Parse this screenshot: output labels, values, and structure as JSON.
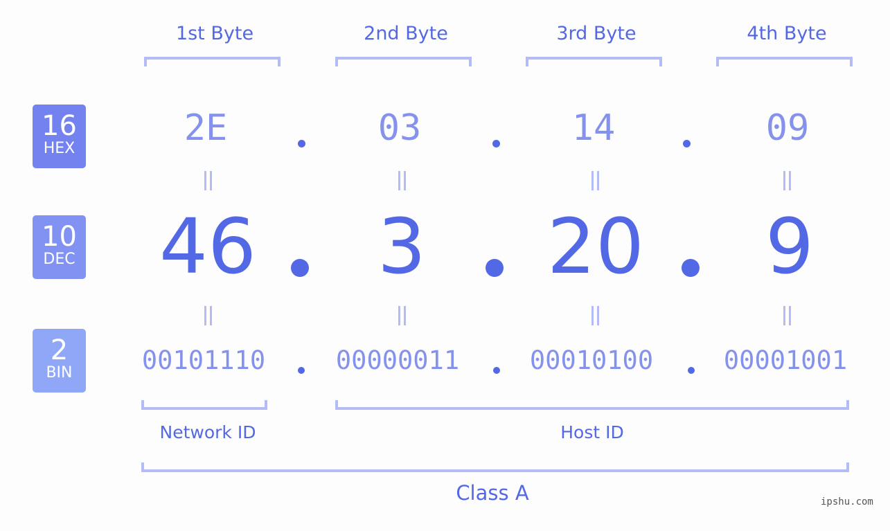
{
  "bytes": [
    {
      "title": "1st Byte",
      "hex": "2E",
      "dec": "46",
      "bin": "00101110"
    },
    {
      "title": "2nd Byte",
      "hex": "03",
      "dec": "3",
      "bin": "00000011"
    },
    {
      "title": "3rd Byte",
      "hex": "14",
      "dec": "20",
      "bin": "00010100"
    },
    {
      "title": "4th Byte",
      "hex": "09",
      "dec": "9",
      "bin": "00001001"
    }
  ],
  "badges": {
    "hex": {
      "num": "16",
      "label": "HEX",
      "color": "#7382ee"
    },
    "dec": {
      "num": "10",
      "label": "DEC",
      "color": "#8292f2"
    },
    "bin": {
      "num": "2",
      "label": "BIN",
      "color": "#90a7f8"
    }
  },
  "sections": {
    "network": "Network ID",
    "host": "Host ID",
    "class": "Class A"
  },
  "watermark": "ipshu.com",
  "colors": {
    "primary": "#5368e4",
    "secondary": "#8592ec",
    "bracket": "#b3bcf6",
    "background": "#fcfdfc"
  }
}
